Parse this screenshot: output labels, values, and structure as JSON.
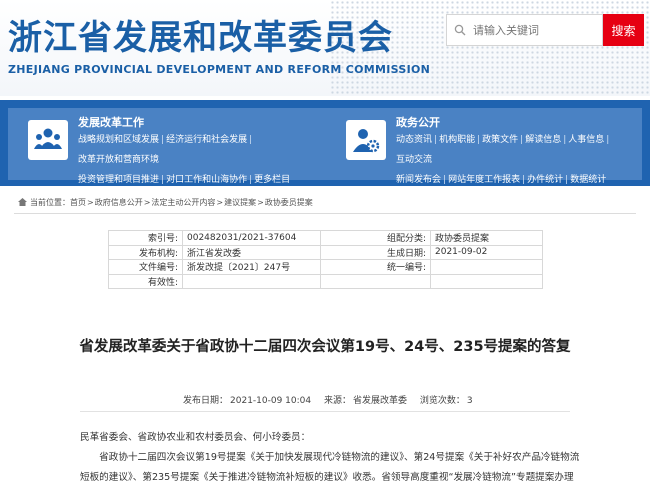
{
  "header": {
    "title": "浙江省发展和改革委员会",
    "subtitle": "ZHEJIANG PROVINCIAL DEVELOPMENT AND REFORM COMMISSION",
    "search_placeholder": "请输入关键词",
    "search_button": "搜索"
  },
  "nav": {
    "left": {
      "title": "发展改革工作",
      "icon": "people-icon",
      "links": [
        "战略规划和区域发展",
        "经济运行和社会发展",
        "改革开放和营商环境",
        "投资管理和项目推进",
        "对口工作和山海协作",
        "更多栏目"
      ]
    },
    "right": {
      "title": "政务公开",
      "icon": "user-gear-icon",
      "links": [
        "动态资讯",
        "机构职能",
        "政策文件",
        "解读信息",
        "人事信息",
        "互动交流",
        "新闻发布会",
        "网站年度工作报表",
        "办件统计",
        "数据统计"
      ]
    }
  },
  "breadcrumb": {
    "prefix": "当前位置：",
    "items": [
      "首页",
      "政府信息公开",
      "法定主动公开内容",
      "建议提案",
      "政协委员提案"
    ],
    "separator": ">"
  },
  "info_table": [
    {
      "label1": "索引号:",
      "value1": "002482031/2021-37604",
      "label2": "组配分类:",
      "value2": "政协委员提案"
    },
    {
      "label1": "发布机构:",
      "value1": "浙江省发改委",
      "label2": "生成日期:",
      "value2": "2021-09-02"
    },
    {
      "label1": "文件编号:",
      "value1": "浙发改提〔2021〕247号",
      "label2": "统一编号:",
      "value2": ""
    },
    {
      "label1": "有效性:",
      "value1": "",
      "label2": "",
      "value2": ""
    }
  ],
  "article": {
    "title": "省发展改革委关于省政协十二届四次会议第19号、24号、235号提案的答复",
    "meta": {
      "date_label": "发布日期：",
      "date": "2021-10-09 10:04",
      "source_label": "来源：",
      "source": "省发展改革委",
      "views_label": "浏览次数：",
      "views": "3"
    },
    "paragraphs": [
      "民革省委会、省政协农业和农村委员会、何小玲委员：",
      "　　省政协十二届四次会议第19号提案《关于加快发展现代冷链物流的建议》、第24号提案《关于补好农产品冷链物流",
      "短板的建议》、第235号提案《关于推进冷链物流补短板的建议》收悉。省领导高度重视“发展冷链物流”专题提案办理"
    ]
  },
  "colors": {
    "brand_blue": "#1a5fa6",
    "nav_blue": "#1f63b0",
    "nav_inner": "#4a82c4",
    "search_red": "#e60012"
  }
}
